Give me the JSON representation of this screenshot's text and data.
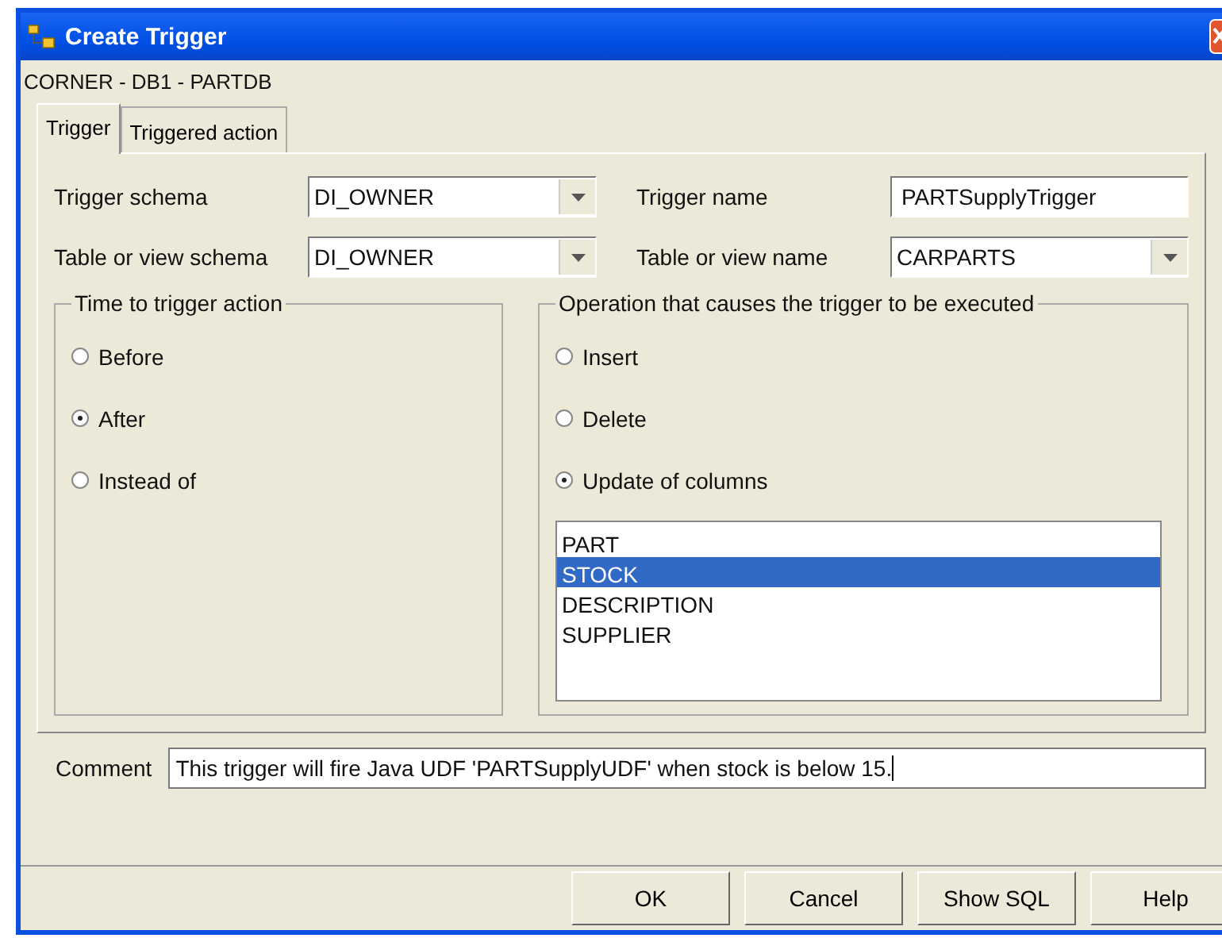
{
  "window": {
    "title": "Create Trigger",
    "subtitle": "CORNER - DB1 - PARTDB"
  },
  "tabs": [
    {
      "label": "Trigger",
      "selected": true
    },
    {
      "label": "Triggered action",
      "selected": false
    }
  ],
  "fields": [
    {
      "kind": "combo",
      "label": "Trigger schema",
      "value": "DI_OWNER"
    },
    {
      "kind": "text",
      "label": "Trigger name",
      "value": "PARTSupplyTrigger"
    },
    {
      "kind": "combo",
      "label": "Table or view schema",
      "value": "DI_OWNER"
    },
    {
      "kind": "combo",
      "label": "Table or view name",
      "value": "CARPARTS"
    }
  ],
  "time_group": {
    "title": "Time to trigger action",
    "options": [
      {
        "label": "Before",
        "selected": false
      },
      {
        "label": "After",
        "selected": true
      },
      {
        "label": "Instead of",
        "selected": false
      }
    ]
  },
  "operation_group": {
    "title": "Operation that causes the trigger to be executed",
    "options": [
      {
        "label": "Insert",
        "selected": false
      },
      {
        "label": "Delete",
        "selected": false
      },
      {
        "label": "Update of columns",
        "selected": true
      }
    ],
    "columns": [
      {
        "label": "PART",
        "selected": false
      },
      {
        "label": "STOCK",
        "selected": true
      },
      {
        "label": "DESCRIPTION",
        "selected": false
      },
      {
        "label": "SUPPLIER",
        "selected": false
      }
    ]
  },
  "comment": {
    "label": "Comment",
    "value": "This trigger will fire Java UDF 'PARTSupplyUDF'  when stock is below 15."
  },
  "buttons": [
    "OK",
    "Cancel",
    "Show SQL",
    "Help"
  ]
}
